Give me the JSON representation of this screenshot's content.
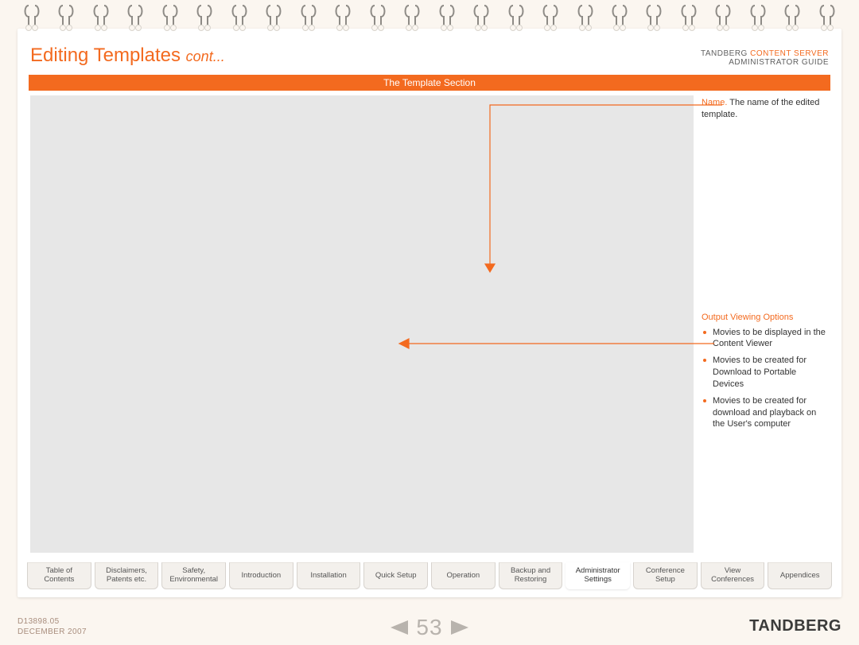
{
  "header": {
    "title_main": "Editing Templates ",
    "title_suffix": "cont...",
    "brand_a": "TANDBERG",
    "brand_b": "CONTENT SERVER",
    "subtitle": "ADMINISTRATOR GUIDE"
  },
  "section_bar": "The Template Section",
  "annotations": {
    "name_label": "Name.",
    "name_text": " The name of the edited template.",
    "ovo_label": "Output Viewing Options",
    "items": [
      "Movies to be displayed in the Content Viewer",
      "Movies to be created for Download to Portable Devices",
      "Movies to be created for download and playback on the User's computer"
    ]
  },
  "tabs": [
    "Table of\nContents",
    "Disclaimers,\nPatents etc.",
    "Safety,\nEnvironmental",
    "Introduction",
    "Installation",
    "Quick Setup",
    "Operation",
    "Backup and\nRestoring",
    "Administrator\nSettings",
    "Conference\nSetup",
    "View\nConferences",
    "Appendices"
  ],
  "active_tab_index": 8,
  "footer": {
    "doc_id": "D13898.05",
    "date": "DECEMBER 2007",
    "page": "53",
    "logo": "TANDBERG"
  }
}
